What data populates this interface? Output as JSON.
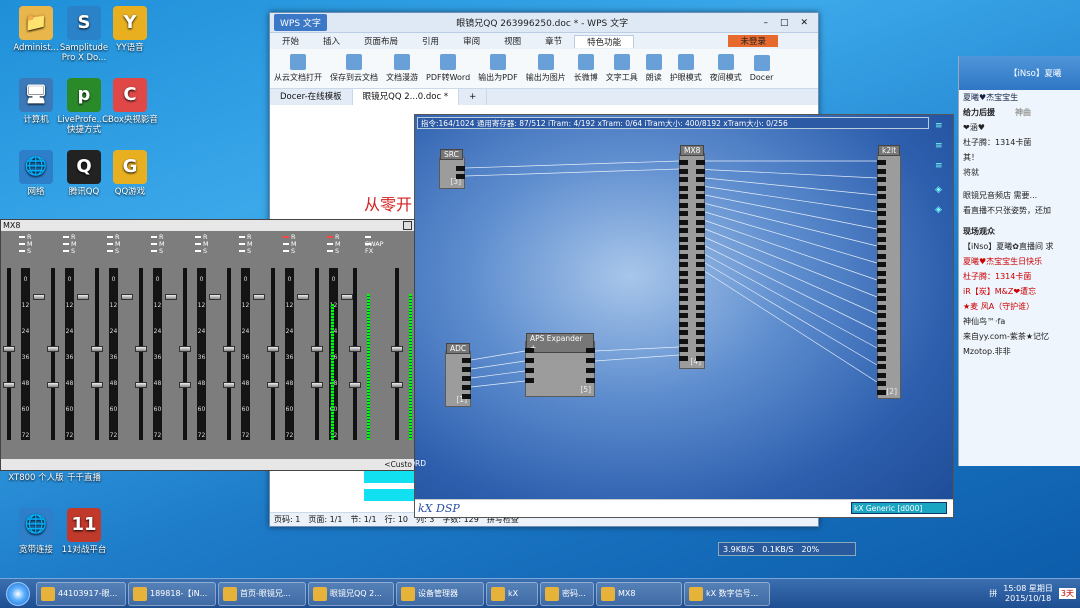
{
  "desktop": {
    "icons": [
      {
        "label": "Administ...",
        "glyph": "📁",
        "color": "#e8b64b"
      },
      {
        "label": "Samplitude Pro X Do...",
        "glyph": "S",
        "color": "#2a82c9"
      },
      {
        "label": "YY语音",
        "glyph": "Y",
        "color": "#e8b020"
      },
      {
        "label": "计算机",
        "glyph": "🖥",
        "color": "#3c79b8"
      },
      {
        "label": "LiveProfe... - 快捷方式",
        "glyph": "p",
        "color": "#2a8a2a"
      },
      {
        "label": "CBox央视影音",
        "glyph": "C",
        "color": "#e04848"
      },
      {
        "label": "网络",
        "glyph": "🌐",
        "color": "#2d7fc9"
      },
      {
        "label": "腾讯QQ",
        "glyph": "Q",
        "color": "#222"
      },
      {
        "label": "QQ游戏",
        "glyph": "G",
        "color": "#e8b020"
      },
      {
        "label": "XT800 个人版",
        "glyph": "X",
        "color": "#2a82c9"
      },
      {
        "label": "千千直播",
        "glyph": "千",
        "color": "#e04848"
      },
      {
        "label": "宽带连接",
        "glyph": "🌐",
        "color": "#2d7fc9"
      },
      {
        "label": "11对战平台",
        "glyph": "11",
        "color": "#c0392b"
      }
    ]
  },
  "wps": {
    "app_button": "WPS 文字",
    "title": "眼镜兄QQ 263996250.doc * - WPS 文字",
    "menu": [
      "开始",
      "插入",
      "页面布局",
      "引用",
      "审阅",
      "视图",
      "章节",
      "特色功能"
    ],
    "active_menu": "特色功能",
    "login": "未登录",
    "ribbon": [
      "从云文档打开",
      "保存到云文档",
      "文档漫游",
      "PDF转Word",
      "输出为PDF",
      "输出为图片",
      "长微博",
      "文字工具",
      "朗读",
      "护眼模式",
      "夜间模式",
      "Docer"
    ],
    "tabs": [
      "Docer-在线模板",
      "眼镜兄QQ 2...0.doc *"
    ],
    "doc_text": "从零开",
    "status": [
      "页码: 1",
      "页面: 1/1",
      "节: 1/1",
      "行: 10",
      "列: 3",
      "字数: 129",
      "拼写检查"
    ]
  },
  "dsp": {
    "info": "指令:164/1024 通用寄存器: 87/512 iTram: 4/192 xTram: 0/64 iTram大小: 400/8192 xTram大小: 0/256",
    "blocks": [
      {
        "name": "SRC",
        "num": "[3]"
      },
      {
        "name": "MX8",
        "num": "[4]"
      },
      {
        "name": "k2lt",
        "num": "[2]"
      },
      {
        "name": "ADC",
        "num": "[1]"
      },
      {
        "name": "APS Expander +",
        "num": "[5]"
      }
    ],
    "footer_label": "kX DSP",
    "footer_box": "kX Generic [d000]"
  },
  "mx8": {
    "title": "MX8",
    "channels": [
      "Chn 1",
      "Chn 2",
      "Chn 3",
      "Chn 4",
      "Chn 5",
      "Chn 6",
      "Chn 7",
      "Chn 8",
      "MAIN",
      "RECORD"
    ],
    "scale": [
      "0",
      "12",
      "24",
      "36",
      "48",
      "60",
      "72"
    ],
    "flags": [
      "R",
      "M",
      "S"
    ],
    "main_flags": [
      "SWAP",
      "FX"
    ],
    "bottom_text": "<Custo"
  },
  "qq": {
    "header": "【iNso】夏曦",
    "tab_left": "给力后援",
    "tab_right": "神曲",
    "user": "夏曦♥杰宝宝生",
    "list_top": [
      "❤涵♥",
      "杜子腾：1314卡菌",
      "其！",
      "将就"
    ],
    "notice": "眼镜兄音频店 需要...",
    "broadcast": "看直播不只张姿势，还加",
    "section": "现场观众",
    "audience": [
      "【iNso】夏曦✿直播间 求",
      "夏曦♥杰宝宝生日快乐",
      "杜子腾：1314卡菌",
      "iR【炭】M&Z❤遭忘",
      "★麦 风A（守护谁）",
      "神仙鸟™·fa",
      "来自yy.com-紫茶★记忆",
      "Mzotop.非非"
    ]
  },
  "netbar": {
    "down": "3.9KB/S",
    "up": "0.1KB/S",
    "pct": "20%"
  },
  "taskbar": {
    "items": [
      "44103917-眼...",
      "189818-【iN...",
      "首页-眼镜兄...",
      "眼镜兄QQ 2...",
      "设备管理器",
      "kX",
      "密码...",
      "MX8",
      "kX 数字信号..."
    ],
    "time": "15:08",
    "date": "2015/10/18",
    "weekday": "星期日",
    "lang": "拼",
    "day_badge": "3天"
  }
}
